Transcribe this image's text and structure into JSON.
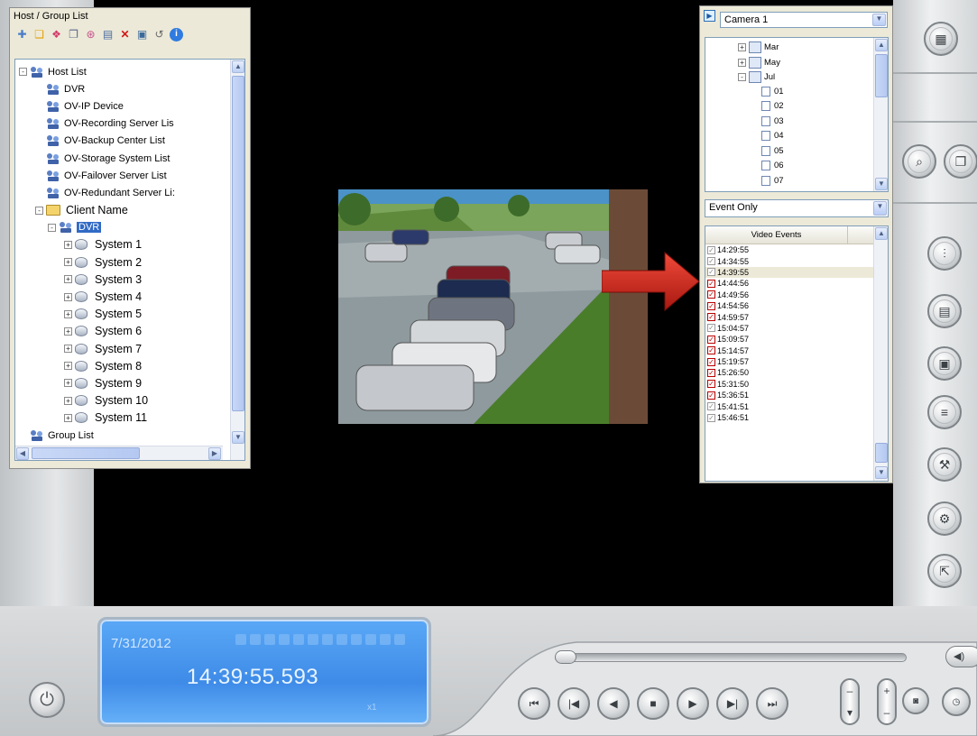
{
  "host_panel": {
    "title": "Host / Group List",
    "toolbar_icons": [
      "add-host-icon",
      "folder-icon",
      "group-icon",
      "copy-icon",
      "connect-icon",
      "network-icon",
      "delete-icon",
      "save-icon",
      "refresh-icon",
      "info-icon"
    ],
    "tree": [
      {
        "label": "Host List",
        "level": 0,
        "icon": "network-icon",
        "expander": "-"
      },
      {
        "label": "DVR",
        "level": 1,
        "icon": "network-icon"
      },
      {
        "label": "OV-IP Device",
        "level": 1,
        "icon": "network-icon"
      },
      {
        "label": "OV-Recording Server Lis",
        "level": 1,
        "icon": "network-icon"
      },
      {
        "label": "OV-Backup Center List",
        "level": 1,
        "icon": "network-icon"
      },
      {
        "label": "OV-Storage System List",
        "level": 1,
        "icon": "network-icon"
      },
      {
        "label": "OV-Failover Server List",
        "level": 1,
        "icon": "network-icon"
      },
      {
        "label": "OV-Redundant Server Li:",
        "level": 1,
        "icon": "network-icon"
      },
      {
        "label": "Client Name",
        "level": 1,
        "icon": "folder-icon",
        "expander": "-",
        "big": true
      },
      {
        "label": "DVR",
        "level": 2,
        "icon": "network-icon",
        "expander": "-",
        "selected": true
      },
      {
        "label": "System 1",
        "level": 3,
        "icon": "disk-icon",
        "expander": "+",
        "big": true
      },
      {
        "label": "System 2",
        "level": 3,
        "icon": "disk-icon",
        "expander": "+",
        "big": true
      },
      {
        "label": "System 3",
        "level": 3,
        "icon": "disk-icon",
        "expander": "+",
        "big": true
      },
      {
        "label": "System 4",
        "level": 3,
        "icon": "disk-icon",
        "expander": "+",
        "big": true
      },
      {
        "label": "System 5",
        "level": 3,
        "icon": "disk-icon",
        "expander": "+",
        "big": true
      },
      {
        "label": "System 6",
        "level": 3,
        "icon": "disk-icon",
        "expander": "+",
        "big": true
      },
      {
        "label": "System 7",
        "level": 3,
        "icon": "disk-icon",
        "expander": "+",
        "big": true
      },
      {
        "label": "System 8",
        "level": 3,
        "icon": "disk-icon",
        "expander": "+",
        "big": true
      },
      {
        "label": "System 9",
        "level": 3,
        "icon": "disk-icon",
        "expander": "+",
        "big": true
      },
      {
        "label": "System 10",
        "level": 3,
        "icon": "disk-icon",
        "expander": "+",
        "big": true
      },
      {
        "label": "System 11",
        "level": 3,
        "icon": "disk-icon",
        "expander": "+",
        "big": true
      },
      {
        "label": "Group List",
        "level": 0,
        "icon": "network-icon"
      }
    ]
  },
  "camera_panel": {
    "camera_select": "Camera 1",
    "date_tree": [
      {
        "label": "Mar",
        "type": "month",
        "expander": "+"
      },
      {
        "label": "May",
        "type": "month",
        "expander": "+"
      },
      {
        "label": "Jul",
        "type": "month",
        "expander": "-"
      },
      {
        "label": "01",
        "type": "day"
      },
      {
        "label": "02",
        "type": "day"
      },
      {
        "label": "03",
        "type": "day"
      },
      {
        "label": "04",
        "type": "day"
      },
      {
        "label": "05",
        "type": "day"
      },
      {
        "label": "06",
        "type": "day"
      },
      {
        "label": "07",
        "type": "day"
      }
    ],
    "filter_select": "Event Only",
    "events_header": "Video Events",
    "events": [
      {
        "time": "14:29:55",
        "checked": false
      },
      {
        "time": "14:34:55",
        "checked": false
      },
      {
        "time": "14:39:55",
        "checked": false,
        "highlighted": true
      },
      {
        "time": "14:44:56",
        "checked": true
      },
      {
        "time": "14:49:56",
        "checked": true
      },
      {
        "time": "14:54:56",
        "checked": true
      },
      {
        "time": "14:59:57",
        "checked": true
      },
      {
        "time": "15:04:57",
        "checked": false
      },
      {
        "time": "15:09:57",
        "checked": true
      },
      {
        "time": "15:14:57",
        "checked": true
      },
      {
        "time": "15:19:57",
        "checked": true
      },
      {
        "time": "15:26:50",
        "checked": true
      },
      {
        "time": "15:31:50",
        "checked": true
      },
      {
        "time": "15:36:51",
        "checked": true
      },
      {
        "time": "15:41:51",
        "checked": false
      },
      {
        "time": "15:46:51",
        "checked": false
      }
    ]
  },
  "side_buttons": [
    "layout-icon",
    "search-icon",
    "copy-icon",
    "mixer-icon",
    "save-icon",
    "export-icon",
    "print-icon",
    "tools-icon",
    "settings-icon",
    "exit-icon"
  ],
  "status": {
    "date": "7/31/2012",
    "time": "14:39:55.593",
    "speed": "x1"
  },
  "playback_buttons": [
    "fast-rewind-icon",
    "previous-icon",
    "rewind-icon",
    "stop-icon",
    "play-icon",
    "next-icon",
    "fast-forward-icon"
  ],
  "colors": {
    "accent": "#316ac5",
    "lcd": "#3e8be8",
    "arrow": "#d42a1e"
  }
}
